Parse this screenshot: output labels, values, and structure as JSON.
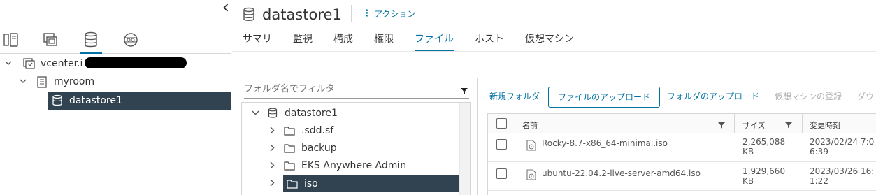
{
  "navigator": {
    "tree": [
      {
        "label": "vcenter.i",
        "icon": "vcenter-icon"
      },
      {
        "label": "myroom",
        "icon": "datacenter-icon"
      },
      {
        "label": "datastore1",
        "icon": "datastore-icon"
      }
    ]
  },
  "header": {
    "object_title": "datastore1",
    "actions_label": "アクション"
  },
  "tabs": [
    "サマリ",
    "監視",
    "構成",
    "権限",
    "ファイル",
    "ホスト",
    "仮想マシン"
  ],
  "active_tab": "ファイル",
  "folder_panel": {
    "filter_placeholder": "フォルダ名でフィルタ",
    "items": [
      {
        "label": "datastore1",
        "icon": "datastore-icon",
        "expanded": true
      },
      {
        "label": ".sdd.sf",
        "icon": "folder-icon"
      },
      {
        "label": "backup",
        "icon": "folder-icon"
      },
      {
        "label": "EKS Anywhere Admin",
        "icon": "folder-icon"
      },
      {
        "label": "iso",
        "icon": "folder-icon",
        "selected": true
      }
    ]
  },
  "file_toolbar": {
    "new_folder": "新規フォルダ",
    "upload_files": "ファイルのアップロード",
    "upload_folder": "フォルダのアップロード",
    "register_vm": "仮想マシンの登録",
    "download": "ダウ"
  },
  "file_grid": {
    "columns": [
      "名前",
      "サイズ",
      "変更時刻"
    ],
    "rows": [
      {
        "name": "Rocky-8.7-x86_64-minimal.iso",
        "size_line1": "2,265,088",
        "size_line2": "KB",
        "modified_line1": "2023/02/24 7:0",
        "modified_line2": "6:39"
      },
      {
        "name": "ubuntu-22.04.2-live-server-amd64.iso",
        "size_line1": "1,929,660",
        "size_line2": "KB",
        "modified_line1": "2023/03/26 16:",
        "modified_line2": "1:22"
      }
    ]
  },
  "colors": {
    "accent": "#0072a3",
    "selected_bg": "#314351"
  }
}
